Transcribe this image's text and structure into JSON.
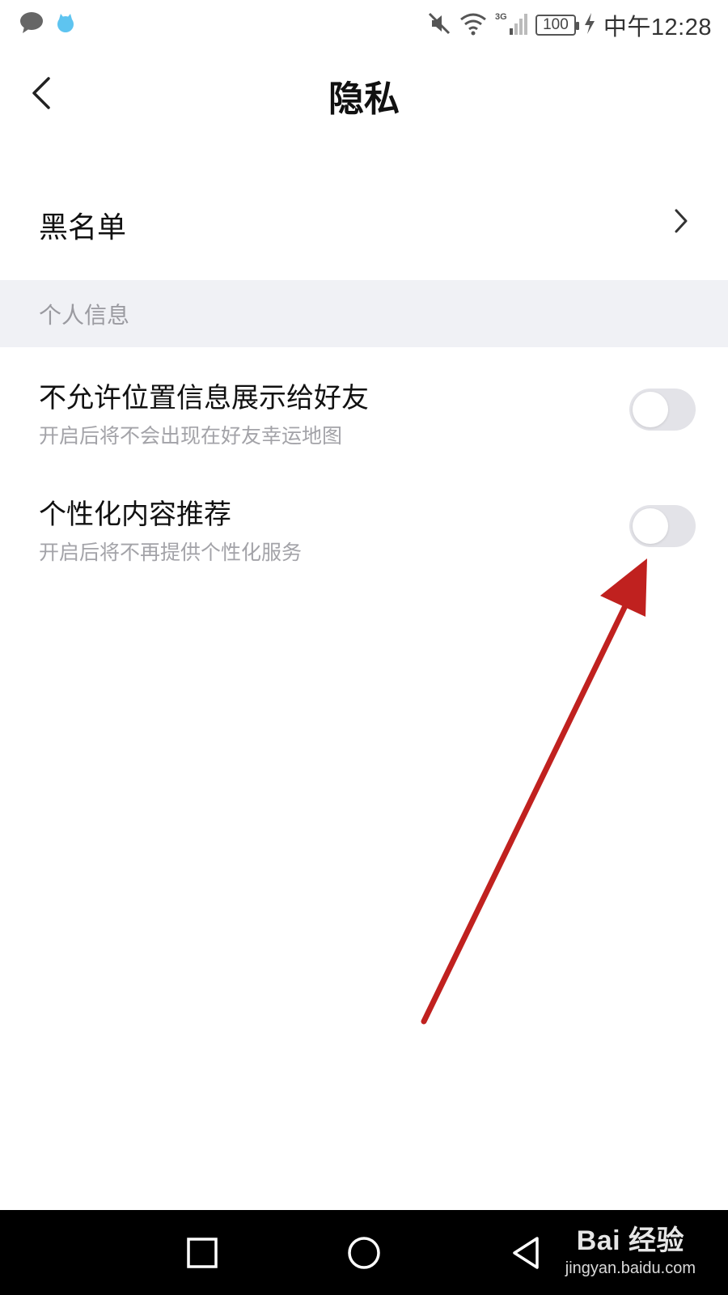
{
  "status_bar": {
    "time": "中午12:28",
    "battery": "100",
    "network": "3G",
    "icons": [
      "chat-icon",
      "app-icon",
      "mute-icon",
      "wifi-icon",
      "signal-icon",
      "charging-icon"
    ]
  },
  "header": {
    "title": "隐私",
    "back_icon": "back-arrow-icon"
  },
  "blacklist": {
    "label": "黑名单",
    "icon": "chevron-right-icon"
  },
  "section": {
    "personal_info": "个人信息"
  },
  "settings": [
    {
      "title": "不允许位置信息展示给好友",
      "subtitle": "开启后将不会出现在好友幸运地图",
      "enabled": false
    },
    {
      "title": "个性化内容推荐",
      "subtitle": "开启后将不再提供个性化服务",
      "enabled": false
    }
  ],
  "annotation": {
    "color": "#c0211f",
    "icon": "red-arrow-annotation"
  },
  "nav_bar": {
    "icons": [
      "recent-apps-icon",
      "home-icon",
      "back-icon"
    ]
  },
  "watermark": {
    "main": "Bai 经验",
    "sub": "jingyan.baidu.com"
  },
  "colors": {
    "switch_off": "#e3e3e8",
    "section_bg": "#f0f1f5",
    "subtitle_text": "#a3a3a8"
  }
}
